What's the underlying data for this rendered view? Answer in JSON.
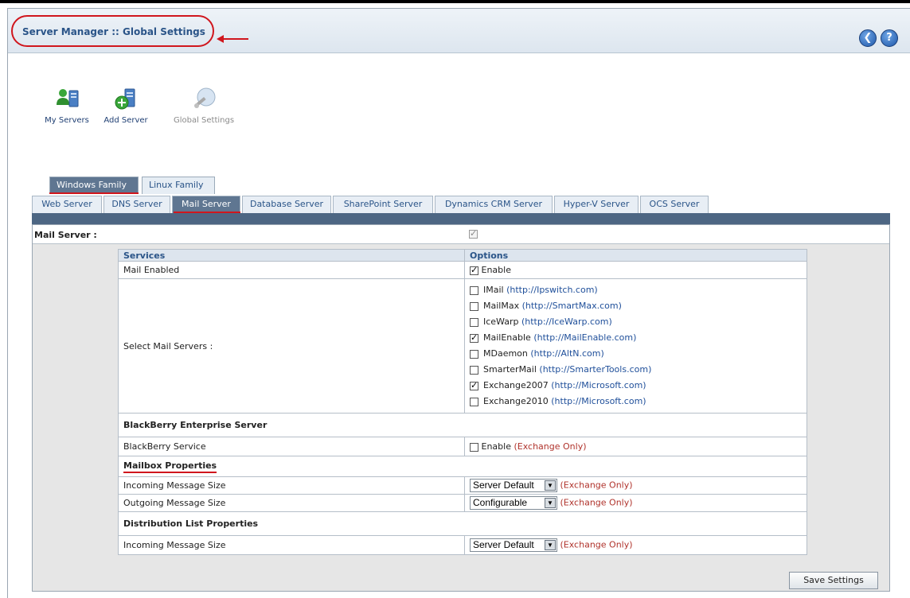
{
  "header": {
    "title": "Server Manager :: Global Settings",
    "back_icon": "circle-left-arrow-icon",
    "help_icon": "question-mark-icon"
  },
  "toolbar": [
    {
      "label": "My Servers",
      "icon": "users-server-icon",
      "enabled": true
    },
    {
      "label": "Add Server",
      "icon": "add-server-icon",
      "enabled": true
    },
    {
      "label": "Global Settings",
      "icon": "settings-wrench-icon",
      "enabled": false
    }
  ],
  "family_tabs": [
    {
      "label": "Windows Family",
      "active": true
    },
    {
      "label": "Linux Family",
      "active": false
    }
  ],
  "server_tabs": [
    {
      "label": "Web Server",
      "active": false
    },
    {
      "label": "DNS Server",
      "active": false
    },
    {
      "label": "Mail Server",
      "active": true
    },
    {
      "label": "Database Server",
      "active": false
    },
    {
      "label": "SharePoint Server",
      "active": false
    },
    {
      "label": "Dynamics CRM Server",
      "active": false
    },
    {
      "label": "Hyper-V Server",
      "active": false
    },
    {
      "label": "OCS Server",
      "active": false
    }
  ],
  "mail_server": {
    "label": "Mail Server :",
    "checked": true,
    "disabled": true
  },
  "table": {
    "col_services": "Services",
    "col_options": "Options",
    "mail_enabled": {
      "label": "Mail Enabled",
      "option": "Enable",
      "checked": true
    },
    "select_mail_servers": {
      "label": "Select Mail Servers :",
      "options": [
        {
          "name": "IMail",
          "url": "(http://Ipswitch.com)",
          "checked": false
        },
        {
          "name": "MailMax",
          "url": "(http://SmartMax.com)",
          "checked": false
        },
        {
          "name": "IceWarp",
          "url": "(http://IceWarp.com)",
          "checked": false
        },
        {
          "name": "MailEnable",
          "url": "(http://MailEnable.com)",
          "checked": true
        },
        {
          "name": "MDaemon",
          "url": "(http://AltN.com)",
          "checked": false
        },
        {
          "name": "SmarterMail",
          "url": "(http://SmarterTools.com)",
          "checked": false
        },
        {
          "name": "Exchange2007",
          "url": "(http://Microsoft.com)",
          "checked": true
        },
        {
          "name": "Exchange2010",
          "url": "(http://Microsoft.com)",
          "checked": false
        }
      ]
    },
    "blackberry_section": "BlackBerry Enterprise Server",
    "blackberry_service": {
      "label": "BlackBerry Service",
      "option": "Enable",
      "note": "(Exchange Only)",
      "checked": false
    },
    "mailbox_section": "Mailbox Properties",
    "mailbox_incoming": {
      "label": "Incoming Message Size",
      "value": "Server Default",
      "note": "(Exchange Only)"
    },
    "mailbox_outgoing": {
      "label": "Outgoing Message Size",
      "value": "Configurable",
      "note": "(Exchange Only)"
    },
    "distribution_section": "Distribution List Properties",
    "dist_incoming": {
      "label": "Incoming Message Size",
      "value": "Server Default",
      "note": "(Exchange Only)"
    }
  },
  "save_button": "Save Settings",
  "colors": {
    "accent_red": "#d0161d",
    "tab_active": "#5f7691",
    "link": "#1f4f9a",
    "title_blue": "#2a5488"
  }
}
